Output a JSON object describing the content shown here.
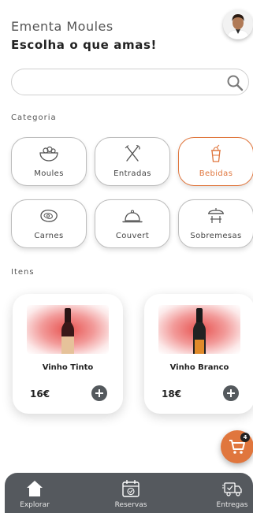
{
  "header": {
    "title": "Ementa Moules",
    "subtitle": "Escolha o que amas!"
  },
  "search": {
    "value": "",
    "placeholder": ""
  },
  "categories_label": "Categoria",
  "categories": [
    {
      "label": "Moules",
      "icon": "bowl-icon",
      "active": false
    },
    {
      "label": "Entradas",
      "icon": "cutlery-icon",
      "active": false
    },
    {
      "label": "Bebidas",
      "icon": "drink-cup-icon",
      "active": true
    },
    {
      "label": "Carnes",
      "icon": "steak-icon",
      "active": false
    },
    {
      "label": "Couvert",
      "icon": "cloche-icon",
      "active": false
    },
    {
      "label": "Sobremesas",
      "icon": "dessert-icon",
      "active": false
    }
  ],
  "items_label": "Itens",
  "items": [
    {
      "name": "Vinho Tinto",
      "price": "16€"
    },
    {
      "name": "Vinho Branco",
      "price": "18€"
    }
  ],
  "cart": {
    "count": "4"
  },
  "nav": [
    {
      "label": "Explorar",
      "icon": "home-icon"
    },
    {
      "label": "Reservas",
      "icon": "calendar-icon"
    },
    {
      "label": "Entregas",
      "icon": "delivery-truck-icon"
    }
  ],
  "colors": {
    "accent": "#e0763d",
    "nav_background": "#55595e",
    "add_button": "#54595d"
  }
}
